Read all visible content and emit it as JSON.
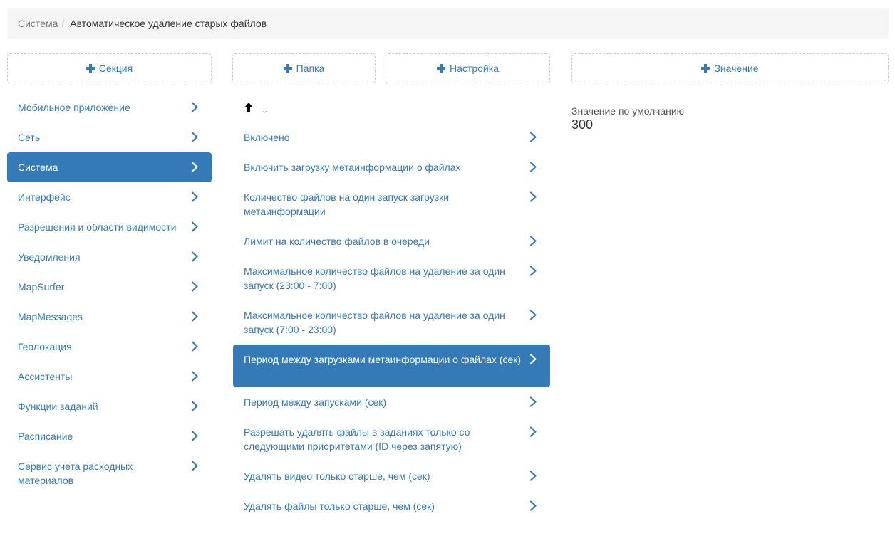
{
  "breadcrumb": {
    "root": "Система",
    "separator": "/",
    "current": "Автоматическое удаление старых файлов"
  },
  "buttons": {
    "section": "Секция",
    "folder": "Папка",
    "setting": "Настройка",
    "value": "Значение"
  },
  "sections": [
    {
      "label": "Мобильное приложение"
    },
    {
      "label": "Сеть"
    },
    {
      "label": "Система",
      "active": true
    },
    {
      "label": "Интерфейс"
    },
    {
      "label": "Разрешения и области видимости"
    },
    {
      "label": "Уведомления"
    },
    {
      "label": "MapSurfer"
    },
    {
      "label": "MapMessages"
    },
    {
      "label": "Геолокация"
    },
    {
      "label": "Ассистенты"
    },
    {
      "label": "Функции заданий"
    },
    {
      "label": "Расписание"
    },
    {
      "label": "Сервис учета расходных материалов"
    }
  ],
  "up_row": {
    "label": ".."
  },
  "settings": [
    {
      "label": "Включено"
    },
    {
      "label": "Включить загрузку метаинформации о файлах"
    },
    {
      "label": "Количество файлов на один запуск загрузки метаинформации"
    },
    {
      "label": "Лимит на количество файлов в очереди"
    },
    {
      "label": "Максимальное количество файлов на удаление за один запуск (23:00 - 7:00)"
    },
    {
      "label": "Максимальное количество файлов на удаление за один запуск (7:00 - 23:00)"
    },
    {
      "label": "Период между загрузками метаинформации о файлах (сек)",
      "active": true
    },
    {
      "label": "Период между запусками (сек)"
    },
    {
      "label": "Разрешать удалять файлы в заданиях только со следующими приоритетами (ID через запятую)"
    },
    {
      "label": "Удалять видео только старше, чем (сек)"
    },
    {
      "label": "Удалять файлы только старше, чем (сек)"
    }
  ],
  "value_panel": {
    "label": "Значение по умолчанию",
    "value": "300"
  },
  "colors": {
    "accent": "#337ab7",
    "breadcrumb_bg": "#f5f5f5",
    "dashed_border": "#cccccc"
  }
}
